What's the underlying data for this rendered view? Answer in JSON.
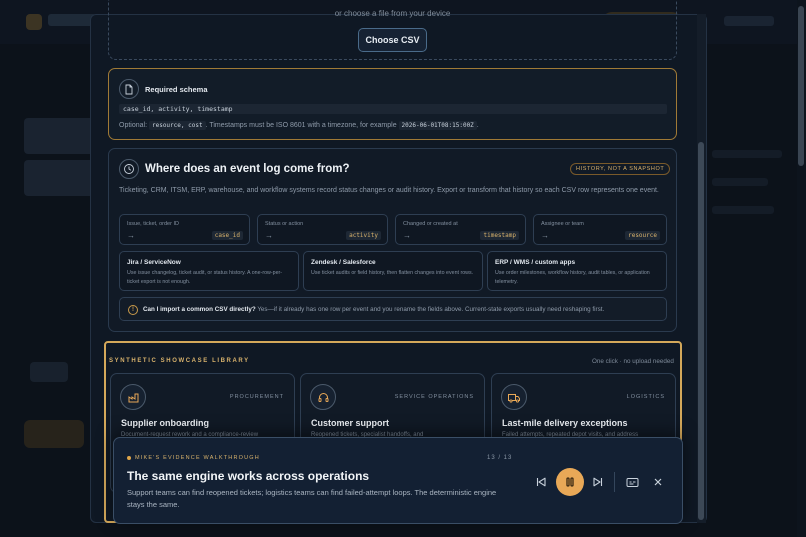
{
  "upload": {
    "hint": "or choose a file from your device",
    "choose_label": "Choose CSV"
  },
  "schema": {
    "title": "Required schema",
    "required_fields": "case_id, activity, timestamp",
    "optional_prefix": "Optional:",
    "optional_fields": "resource, cost",
    "optional_suffix": ". Timestamps must be ISO 8601 with a timezone, for example",
    "example_timestamp": "2026-06-01T08:15:00Z",
    "period": "."
  },
  "event_source": {
    "title": "Where does an event log come from?",
    "badge": "HISTORY, NOT A SNAPSHOT",
    "description": "Ticketing, CRM, ITSM, ERP, warehouse, and workflow systems record status changes or audit history. Export or transform that history so each CSV row represents one event.",
    "fields": [
      {
        "label": "Issue, ticket, order ID",
        "column": "case_id"
      },
      {
        "label": "Status or action",
        "column": "activity"
      },
      {
        "label": "Changed or created at",
        "column": "timestamp"
      },
      {
        "label": "Assignee or team",
        "column": "resource"
      }
    ],
    "sources": [
      {
        "title": "Jira / ServiceNow",
        "desc": "Use issue changelog, ticket audit, or status history. A one-row-per-ticket export is not enough."
      },
      {
        "title": "Zendesk / Salesforce",
        "desc": "Use ticket audits or field history, then flatten changes into event rows."
      },
      {
        "title": "ERP / WMS / custom apps",
        "desc": "Use order milestones, workflow history, audit tables, or application telemetry."
      }
    ],
    "faq_question": "Can I import a common CSV directly?",
    "faq_answer": "Yes—if it already has one row per event and you rename the fields above. Current-state exports usually need reshaping first."
  },
  "showcase": {
    "title": "SYNTHETIC SHOWCASE LIBRARY",
    "note": "One click · no upload needed",
    "cards": [
      {
        "category": "PROCUREMENT",
        "name": "Supplier onboarding",
        "desc": "Document-request rework and a compliance-review",
        "icon": "factory-icon"
      },
      {
        "category": "SERVICE OPERATIONS",
        "name": "Customer support",
        "desc": "Reopened tickets, specialist handoffs, and",
        "icon": "headset-icon"
      },
      {
        "category": "LOGISTICS",
        "name": "Last-mile delivery exceptions",
        "desc": "Failed attempts, repeated depot visits, and address",
        "icon": "truck-icon"
      }
    ]
  },
  "walkthrough": {
    "kicker": "MIKE'S EVIDENCE WALKTHROUGH",
    "step": "13 / 13",
    "title": "The same engine works across operations",
    "body": "Support teams can find reopened tickets; logistics teams can find failed-attempt loops. The deterministic engine stays the same."
  },
  "colors": {
    "accent": "#e8a857",
    "schema_border": "#a07a36",
    "panel": "#132033"
  }
}
